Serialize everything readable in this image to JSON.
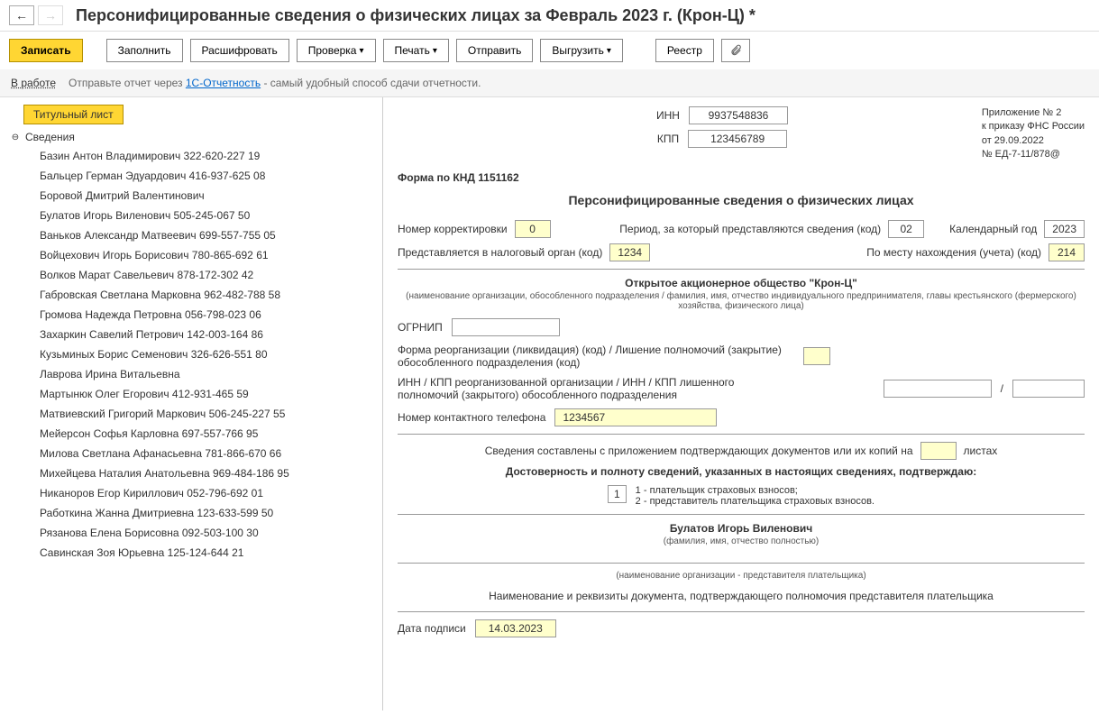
{
  "title": "Персонифицированные сведения о физических лицах за Февраль 2023 г. (Крон-Ц) *",
  "nav": {
    "back": "←",
    "fwd": "→"
  },
  "toolbar": {
    "save": "Записать",
    "fill": "Заполнить",
    "decrypt": "Расшифровать",
    "check": "Проверка",
    "print": "Печать",
    "send": "Отправить",
    "unload": "Выгрузить",
    "registry": "Реестр"
  },
  "status": {
    "in_work": "В работе",
    "text_before": "Отправьте отчет через ",
    "link": "1С-Отчетность",
    "text_after": " - самый удобный способ сдачи отчетности."
  },
  "sidebar": {
    "title_tab": "Титульный лист",
    "data_label": "Сведения",
    "items": [
      "Базин Антон Владимирович 322-620-227 19",
      "Бальцер Герман Эдуардович 416-937-625 08",
      "Боровой Дмитрий Валентинович",
      "Булатов Игорь Виленович 505-245-067 50",
      "Ваньков Александр Матвеевич 699-557-755 05",
      "Войцехович Игорь Борисович 780-865-692 61",
      "Волков Марат Савельевич 878-172-302 42",
      "Габровская Светлана Марковна 962-482-788 58",
      "Громова Надежда Петровна 056-798-023 06",
      "Захаркин Савелий Петрович 142-003-164 86",
      "Кузьминых Борис Семенович 326-626-551 80",
      "Лаврова Ирина Витальевна",
      "Мартынюк Олег Егорович 412-931-465 59",
      "Матвиевский Григорий Маркович 506-245-227 55",
      "Мейерсон Софья Карловна 697-557-766 95",
      "Милова Светлана Афанасьевна 781-866-670 66",
      "Михейцева Наталия Анатольевна 969-484-186 95",
      "Никаноров Егор Кириллович 052-796-692 01",
      "Работкина Жанна Дмитриевна 123-633-599 50",
      "Рязанова Елена Борисовна 092-503-100 30",
      "Савинская Зоя Юрьевна 125-124-644 21"
    ]
  },
  "form": {
    "inn_label": "ИНН",
    "inn": "9937548836",
    "kpp_label": "КПП",
    "kpp": "123456789",
    "appendix": {
      "l1": "Приложение № 2",
      "l2": "к приказу ФНС России",
      "l3": "от 29.09.2022",
      "l4": "№ ЕД-7-11/878@"
    },
    "form_code": "Форма по КНД 1151162",
    "doc_title": "Персонифицированные сведения о физических лицах",
    "correction_label": "Номер корректировки",
    "correction": "0",
    "period_label": "Период, за который представляются сведения (код)",
    "period": "02",
    "year_label": "Календарный год",
    "year": "2023",
    "tax_label": "Представляется в налоговый орган (код)",
    "tax": "1234",
    "location_label": "По месту нахождения (учета) (код)",
    "location": "214",
    "org_name": "Открытое акционерное общество \"Крон-Ц\"",
    "org_hint": "(наименование организации, обособленного подразделения / фамилия, имя, отчество индивидуального предпринимателя, главы крестьянского (фермерского) хозяйства, физического лица)",
    "ogrnip_label": "ОГРНИП",
    "reorg_label": "Форма реорганизации (ликвидация) (код) / Лишение полномочий (закрытие) обособленного подразделения (код)",
    "inn_kpp_reorg_label": "ИНН / КПП реорганизованной организации / ИНН / КПП лишенного полномочий (закрытого) обособленного подразделения",
    "slash": "/",
    "phone_label": "Номер контактного телефона",
    "phone": "1234567",
    "sheets_text_before": "Сведения составлены с приложением подтверждающих документов или их копий на",
    "sheets_text_after": "листах",
    "confirm_title": "Достоверность и полноту сведений, указанных в настоящих сведениях, подтверждаю:",
    "confirm_num": "1",
    "confirm_opt1": "1 - плательщик страховых взносов;",
    "confirm_opt2": "2 - представитель плательщика страховых взносов.",
    "signer": "Булатов Игорь Виленович",
    "signer_hint": "(фамилия, имя, отчество полностью)",
    "rep_hint": "(наименование организации - представителя плательщика)",
    "doc_req": "Наименование и реквизиты документа, подтверждающего полномочия представителя плательщика",
    "sign_date_label": "Дата подписи",
    "sign_date": "14.03.2023"
  }
}
